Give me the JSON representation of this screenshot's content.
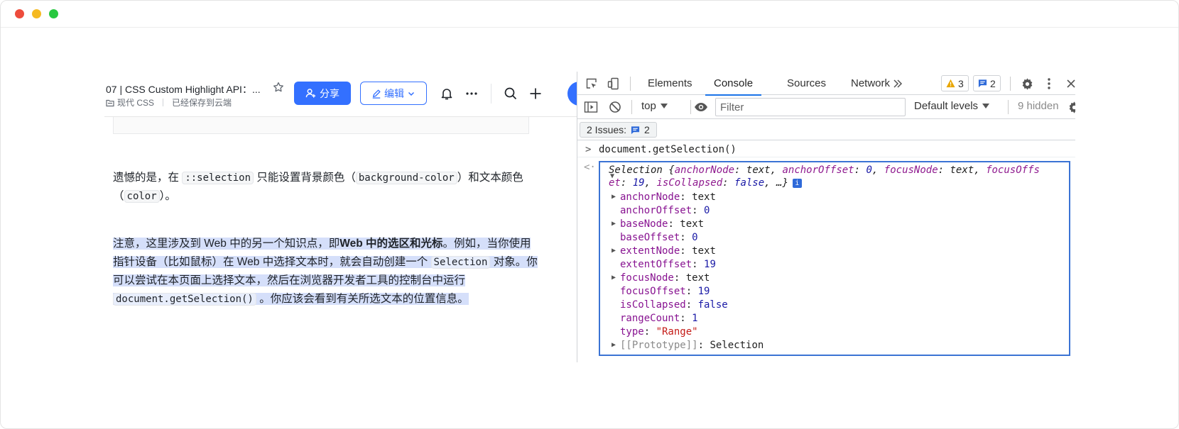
{
  "doc": {
    "title": "07 | CSS Custom Highlight API：...",
    "folder": "现代 CSS",
    "save_status": "已经保存到云端",
    "share_label": "分享",
    "edit_label": "编辑",
    "para1": {
      "t1": "遗憾的是，在",
      "c1": "::selection",
      "t2": "只能设置背景颜色（",
      "c2": "background-color",
      "t3": "）和文本颜色（",
      "c3": "color",
      "t4": "）。"
    },
    "para2": {
      "t1": "注意，这里涉及到 Web 中的另一个知识点，即",
      "b1": "Web 中的选区和光标",
      "t2": "。例如，当你使用指针设备（比如鼠标）在 Web 中选择文本时，就会自动创建一个",
      "c1": "Selection",
      "t3": "对象。你可以尝试在本页面上选择文本，然后在浏览器开发者工具的控制台中运行",
      "c2": "document.getSelection()",
      "t4": "。你应该会看到有关所选文本的位置信息。"
    }
  },
  "devtools": {
    "tabs": [
      "Elements",
      "Console",
      "Sources",
      "Network"
    ],
    "active_tab": "Console",
    "warnings_count": "3",
    "messages_count": "2",
    "context": "top",
    "filter_placeholder": "Filter",
    "levels": "Default levels",
    "hidden": "9 hidden",
    "issues_label": "2 Issues:",
    "issues_count": "2",
    "command": "document.getSelection()",
    "summary": {
      "type": "Selection",
      "open": "{",
      "k1": "anchorNode",
      "v1": "text",
      "k2": "anchorOffset",
      "v2": "0",
      "k3": "focusNode",
      "v3": "text",
      "k4a": "focusOffs",
      "k4b": "et",
      "v4": "19",
      "k5": "isCollapsed",
      "v5": "false",
      "tail": ", …}"
    },
    "properties": [
      {
        "key": "anchorNode",
        "value": "text",
        "kind": "obj",
        "expandable": true
      },
      {
        "key": "anchorOffset",
        "value": "0",
        "kind": "num",
        "expandable": false
      },
      {
        "key": "baseNode",
        "value": "text",
        "kind": "obj",
        "expandable": true
      },
      {
        "key": "baseOffset",
        "value": "0",
        "kind": "num",
        "expandable": false
      },
      {
        "key": "extentNode",
        "value": "text",
        "kind": "obj",
        "expandable": true
      },
      {
        "key": "extentOffset",
        "value": "19",
        "kind": "num",
        "expandable": false
      },
      {
        "key": "focusNode",
        "value": "text",
        "kind": "obj",
        "expandable": true
      },
      {
        "key": "focusOffset",
        "value": "19",
        "kind": "num",
        "expandable": false
      },
      {
        "key": "isCollapsed",
        "value": "false",
        "kind": "bool",
        "expandable": false
      },
      {
        "key": "rangeCount",
        "value": "1",
        "kind": "num",
        "expandable": false
      },
      {
        "key": "type",
        "value": "\"Range\"",
        "kind": "str",
        "expandable": false
      },
      {
        "key": "[[Prototype]]",
        "value": "Selection",
        "kind": "proto",
        "expandable": true
      }
    ]
  },
  "colors": {
    "accent": "#3370ff",
    "selection_highlight": "#d5dffa",
    "devtools_focus": "#3b73d4"
  }
}
